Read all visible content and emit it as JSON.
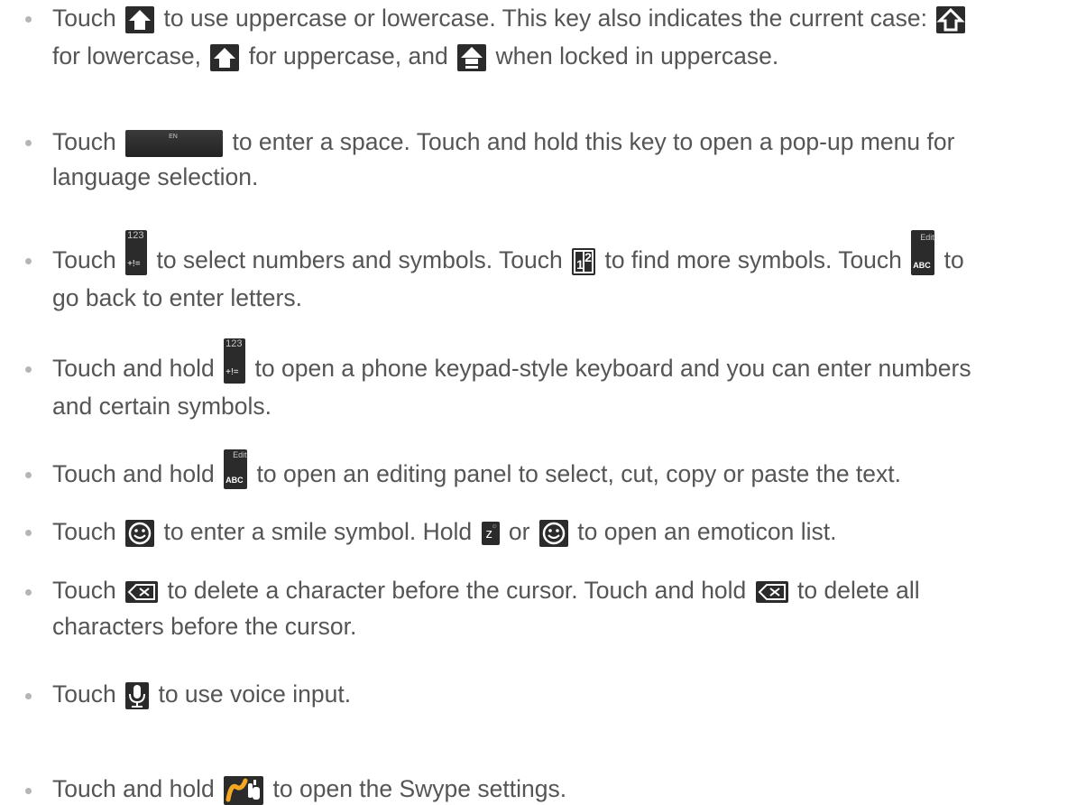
{
  "items": [
    {
      "lines": [
        [
          "Touch",
          "to use uppercase or lowercase. This key also indicates the current case:"
        ],
        [
          "for lowercase,",
          "for uppercase, and",
          "when locked in uppercase."
        ]
      ]
    },
    {
      "lines": [
        [
          "Touch",
          "to enter a space. Touch and hold this key to open a pop-up menu for"
        ],
        [
          "language selection."
        ]
      ]
    },
    {
      "lines": [
        [
          "Touch",
          "to select numbers and symbols. Touch",
          "to find more symbols. Touch",
          "to"
        ],
        [
          "go back to enter letters."
        ]
      ]
    },
    {
      "lines": [
        [
          "Touch and hold",
          "to open a phone keypad-style keyboard and you can enter numbers"
        ],
        [
          "and certain symbols."
        ]
      ]
    },
    {
      "lines": [
        [
          "Touch and hold",
          "to open an editing panel to select, cut, copy or paste the text."
        ]
      ]
    },
    {
      "lines": [
        [
          "Touch",
          "to enter a smile symbol. Hold",
          "or",
          "to open an emoticon list."
        ]
      ]
    },
    {
      "lines": [
        [
          "Touch",
          "to delete a character before the cursor. Touch and hold",
          "to delete all"
        ],
        [
          "characters before the cursor."
        ]
      ]
    },
    {
      "lines": [
        [
          "Touch",
          "to use voice input."
        ]
      ]
    },
    {
      "lines": [
        [
          "Touch and hold",
          "to open the Swype settings."
        ]
      ]
    }
  ],
  "key_labels": {
    "space": "EN",
    "sym_top": "123",
    "sym_bottom": "+!=",
    "edit_top": "Edit",
    "edit_bottom": "ABC",
    "more_sym_a": "1",
    "more_sym_b": "2",
    "z_key": "z",
    "z_key_sub": "☺"
  },
  "icons": {
    "shift": "shift-arrow-icon",
    "space": "space-key-icon",
    "symbols": "symbols-key-icon",
    "more_symbols": "more-symbols-key-icon",
    "abc": "abc-edit-key-icon",
    "smiley": "smiley-icon",
    "z": "z-key-icon",
    "backspace": "backspace-icon",
    "mic": "microphone-icon",
    "swype": "swype-icon"
  },
  "colors": {
    "text": "#555555",
    "bullet": "#b5b5b5",
    "key_bg": "#2b2b2b",
    "swype_orange": "#f5a623"
  }
}
